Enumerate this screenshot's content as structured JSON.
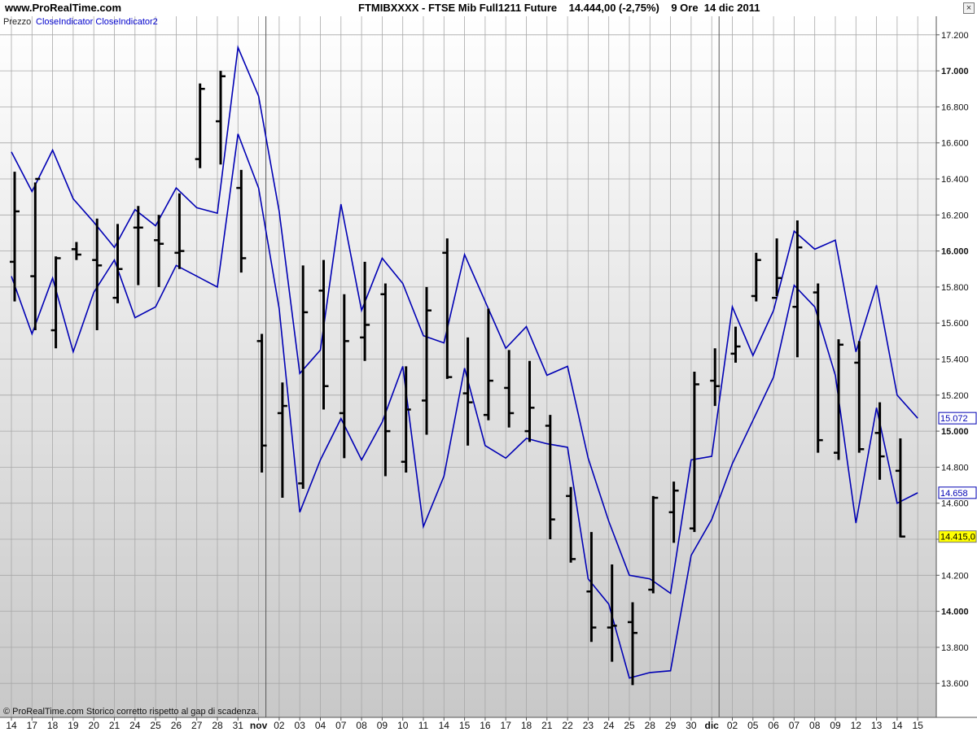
{
  "header": {
    "site": "www.ProRealTime.com",
    "title": "FTMIBXXXX - FTSE Mib Full1211 Future    14.444,00 (-2,75%)    9 Ore  14 dic 2011",
    "close_symbol": "×"
  },
  "legend": {
    "prefix": "Prezzo",
    "indicators": "CloseIndicator CloseIndicator2"
  },
  "footer": "© ProRealTime.com  Storico corretto rispetto al gap di scadenza.",
  "colors": {
    "price_bar": "#000000",
    "indicator": "#0000b4",
    "last_price_badge": "#ffff00",
    "background_top": "#ffffff",
    "background_bottom": "#c8c8c8"
  },
  "chart_data": {
    "type": "ohlc_bar",
    "title": "FTMIBXXXX - FTSE Mib Full1211 Future",
    "grid": true,
    "ylim": [
      13500,
      17300
    ],
    "y_ticks": [
      "13.600",
      "13.800",
      "14.000",
      "14.200",
      "14.400",
      "14.600",
      "14.800",
      "15.000",
      "15.200",
      "15.400",
      "15.600",
      "15.800",
      "16.000",
      "16.200",
      "16.400",
      "16.600",
      "16.800",
      "17.000",
      "17.200"
    ],
    "y_tick_values": [
      13600,
      13800,
      14000,
      14200,
      14400,
      14600,
      14800,
      15000,
      15200,
      15400,
      15600,
      15800,
      16000,
      16200,
      16400,
      16600,
      16800,
      17000,
      17200
    ],
    "bold_ticks": [
      "14.000",
      "15.000",
      "16.000",
      "17.000"
    ],
    "x_labels": [
      "14",
      "17",
      "18",
      "19",
      "20",
      "21",
      "24",
      "25",
      "26",
      "27",
      "28",
      "31",
      "nov",
      "02",
      "03",
      "04",
      "07",
      "08",
      "09",
      "10",
      "11",
      "14",
      "15",
      "16",
      "17",
      "18",
      "21",
      "22",
      "23",
      "24",
      "25",
      "28",
      "29",
      "30",
      "dic",
      "02",
      "05",
      "06",
      "07",
      "08",
      "09",
      "12",
      "13",
      "14",
      "15"
    ],
    "month_separators": [
      "nov",
      "dic"
    ],
    "bars": [
      {
        "open": 15940,
        "high": 16440,
        "low": 15720,
        "close": 16220
      },
      {
        "open": 15860,
        "high": 16380,
        "low": 15560,
        "close": 16400
      },
      {
        "open": 15560,
        "high": 15970,
        "low": 15460,
        "close": 15960
      },
      {
        "open": 16010,
        "high": 16050,
        "low": 15950,
        "close": 15980
      },
      {
        "open": 15950,
        "high": 16180,
        "low": 15560,
        "close": 15920
      },
      {
        "open": 15740,
        "high": 16150,
        "low": 15710,
        "close": 15900
      },
      {
        "open": 16130,
        "high": 16250,
        "low": 15810,
        "close": 16130
      },
      {
        "open": 16060,
        "high": 16200,
        "low": 15800,
        "close": 16040
      },
      {
        "open": 15990,
        "high": 16320,
        "low": 15900,
        "close": 16000
      },
      {
        "open": 16510,
        "high": 16930,
        "low": 16460,
        "close": 16900
      },
      {
        "open": 16720,
        "high": 17000,
        "low": 16480,
        "close": 16970
      },
      {
        "open": 16350,
        "high": 16450,
        "low": 15880,
        "close": 15960
      },
      {
        "open": 15500,
        "high": 15540,
        "low": 14770,
        "close": 14920
      },
      {
        "open": 15100,
        "high": 15270,
        "low": 14630,
        "close": 15140
      },
      {
        "open": 14710,
        "high": 15920,
        "low": 14680,
        "close": 15660
      },
      {
        "open": 15780,
        "high": 15950,
        "low": 15120,
        "close": 15250
      },
      {
        "open": 15100,
        "high": 15760,
        "low": 14850,
        "close": 15500
      },
      {
        "open": 15520,
        "high": 15940,
        "low": 15390,
        "close": 15590
      },
      {
        "open": 15760,
        "high": 15820,
        "low": 14750,
        "close": 15000
      },
      {
        "open": 14830,
        "high": 15360,
        "low": 14770,
        "close": 15120
      },
      {
        "open": 15170,
        "high": 15800,
        "low": 14980,
        "close": 15670
      },
      {
        "open": 15990,
        "high": 16070,
        "low": 15290,
        "close": 15300
      },
      {
        "open": 15210,
        "high": 15520,
        "low": 14920,
        "close": 15160
      },
      {
        "open": 15090,
        "high": 15680,
        "low": 15060,
        "close": 15280
      },
      {
        "open": 15240,
        "high": 15450,
        "low": 15020,
        "close": 15100
      },
      {
        "open": 15000,
        "high": 15390,
        "low": 14940,
        "close": 15130
      },
      {
        "open": 15030,
        "high": 15090,
        "low": 14400,
        "close": 14510
      },
      {
        "open": 14640,
        "high": 14690,
        "low": 14270,
        "close": 14290
      },
      {
        "open": 14110,
        "high": 14440,
        "low": 13830,
        "close": 13910
      },
      {
        "open": 13910,
        "high": 14260,
        "low": 13720,
        "close": 13920
      },
      {
        "open": 13940,
        "high": 14050,
        "low": 13590,
        "close": 13880
      },
      {
        "open": 14120,
        "high": 14640,
        "low": 14100,
        "close": 14630
      },
      {
        "open": 14550,
        "high": 14720,
        "low": 14380,
        "close": 14670
      },
      {
        "open": 14460,
        "high": 15330,
        "low": 14440,
        "close": 15260
      },
      {
        "open": 15280,
        "high": 15460,
        "low": 15140,
        "close": 15250
      },
      {
        "open": 15430,
        "high": 15580,
        "low": 15380,
        "close": 15470
      },
      {
        "open": 15750,
        "high": 15990,
        "low": 15720,
        "close": 15950
      },
      {
        "open": 15740,
        "high": 16070,
        "low": 15750,
        "close": 15850
      },
      {
        "open": 15690,
        "high": 16170,
        "low": 15410,
        "close": 16020
      },
      {
        "open": 15770,
        "high": 15820,
        "low": 14880,
        "close": 14950
      },
      {
        "open": 14880,
        "high": 15510,
        "low": 14840,
        "close": 15480
      },
      {
        "open": 15380,
        "high": 15500,
        "low": 14880,
        "close": 14900
      },
      {
        "open": 14990,
        "high": 15160,
        "low": 14730,
        "close": 14860
      },
      {
        "open": 14780,
        "high": 14960,
        "low": 14410,
        "close": 14415
      }
    ],
    "series": [
      {
        "name": "CloseIndicator",
        "values": [
          16550,
          16330,
          16560,
          16290,
          16160,
          16020,
          16230,
          16140,
          16350,
          16240,
          16210,
          17130,
          16860,
          16220,
          15320,
          15450,
          16260,
          15670,
          15960,
          15820,
          15530,
          15490,
          15980,
          15720,
          15460,
          15580,
          15310,
          15360,
          14850,
          14500,
          14200,
          14180,
          14100,
          14840,
          14860,
          15690,
          15420,
          15670,
          16110,
          16010,
          16060,
          15440,
          15810,
          15200,
          15072
        ]
      },
      {
        "name": "CloseIndicator2",
        "values": [
          15860,
          15540,
          15850,
          15440,
          15770,
          15950,
          15630,
          15690,
          15920,
          15860,
          15800,
          16650,
          16350,
          15680,
          14550,
          14840,
          15070,
          14840,
          15050,
          15360,
          14470,
          14750,
          15350,
          14920,
          14850,
          14960,
          14930,
          14910,
          14180,
          14040,
          13630,
          13660,
          13670,
          14310,
          14510,
          14820,
          15060,
          15300,
          15810,
          15690,
          15310,
          14490,
          15130,
          14600,
          14658
        ]
      }
    ],
    "price_labels": [
      {
        "text": "15.072",
        "kind": "indicator",
        "value": 15072
      },
      {
        "text": "14.658",
        "kind": "indicator",
        "value": 14658
      },
      {
        "text": "14.415,0",
        "kind": "last",
        "value": 14415
      }
    ]
  }
}
